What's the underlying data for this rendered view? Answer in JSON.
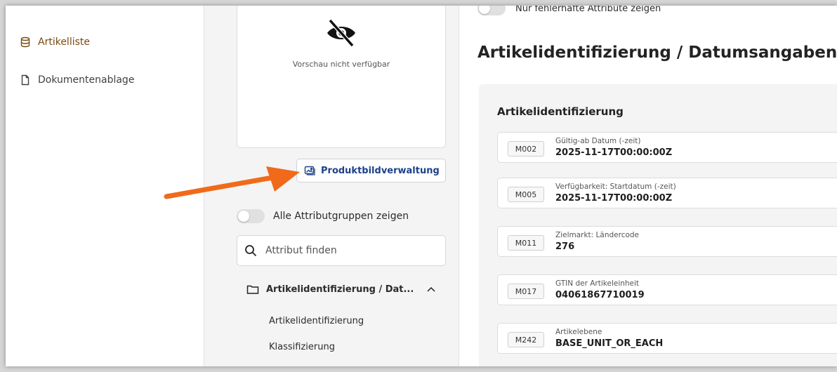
{
  "nav": {
    "items": [
      {
        "label": "Artikelliste"
      },
      {
        "label": "Dokumentenablage"
      }
    ]
  },
  "preview": {
    "text": "Vorschau nicht verfügbar"
  },
  "image_button": {
    "label": "Produktbildverwaltung"
  },
  "toggle_groups": {
    "label": "Alle Attributgruppen zeigen"
  },
  "search": {
    "placeholder": "Attribut finden"
  },
  "groups": {
    "head": "Artikelidentifizierung / Dat...",
    "sub_items": [
      {
        "label": "Artikelidentifizierung"
      },
      {
        "label": "Klassifizierung"
      }
    ]
  },
  "main": {
    "toggle_label": "Nur fehlerhafte Attribute zeigen",
    "title": "Artikelidentifizierung / Datumsangaben /",
    "section_title": "Artikelidentifizierung",
    "attributes": [
      {
        "code": "M002",
        "label": "Gültig-ab Datum (-zeit)",
        "value": "2025-11-17T00:00:00Z"
      },
      {
        "code": "M005",
        "label": "Verfügbarkeit: Startdatum (-zeit)",
        "value": "2025-11-17T00:00:00Z"
      },
      {
        "code": "M011",
        "label": "Zielmarkt: Ländercode",
        "value": "276"
      },
      {
        "code": "M017",
        "label": "GTIN der Artikeleinheit",
        "value": "04061867710019"
      },
      {
        "code": "M242",
        "label": "Artikelebene",
        "value": "BASE_UNIT_OR_EACH"
      }
    ]
  },
  "colors": {
    "accent_nav": "#7a4a10",
    "button_text": "#1d4189",
    "annotation_arrow": "#f06a1a"
  }
}
